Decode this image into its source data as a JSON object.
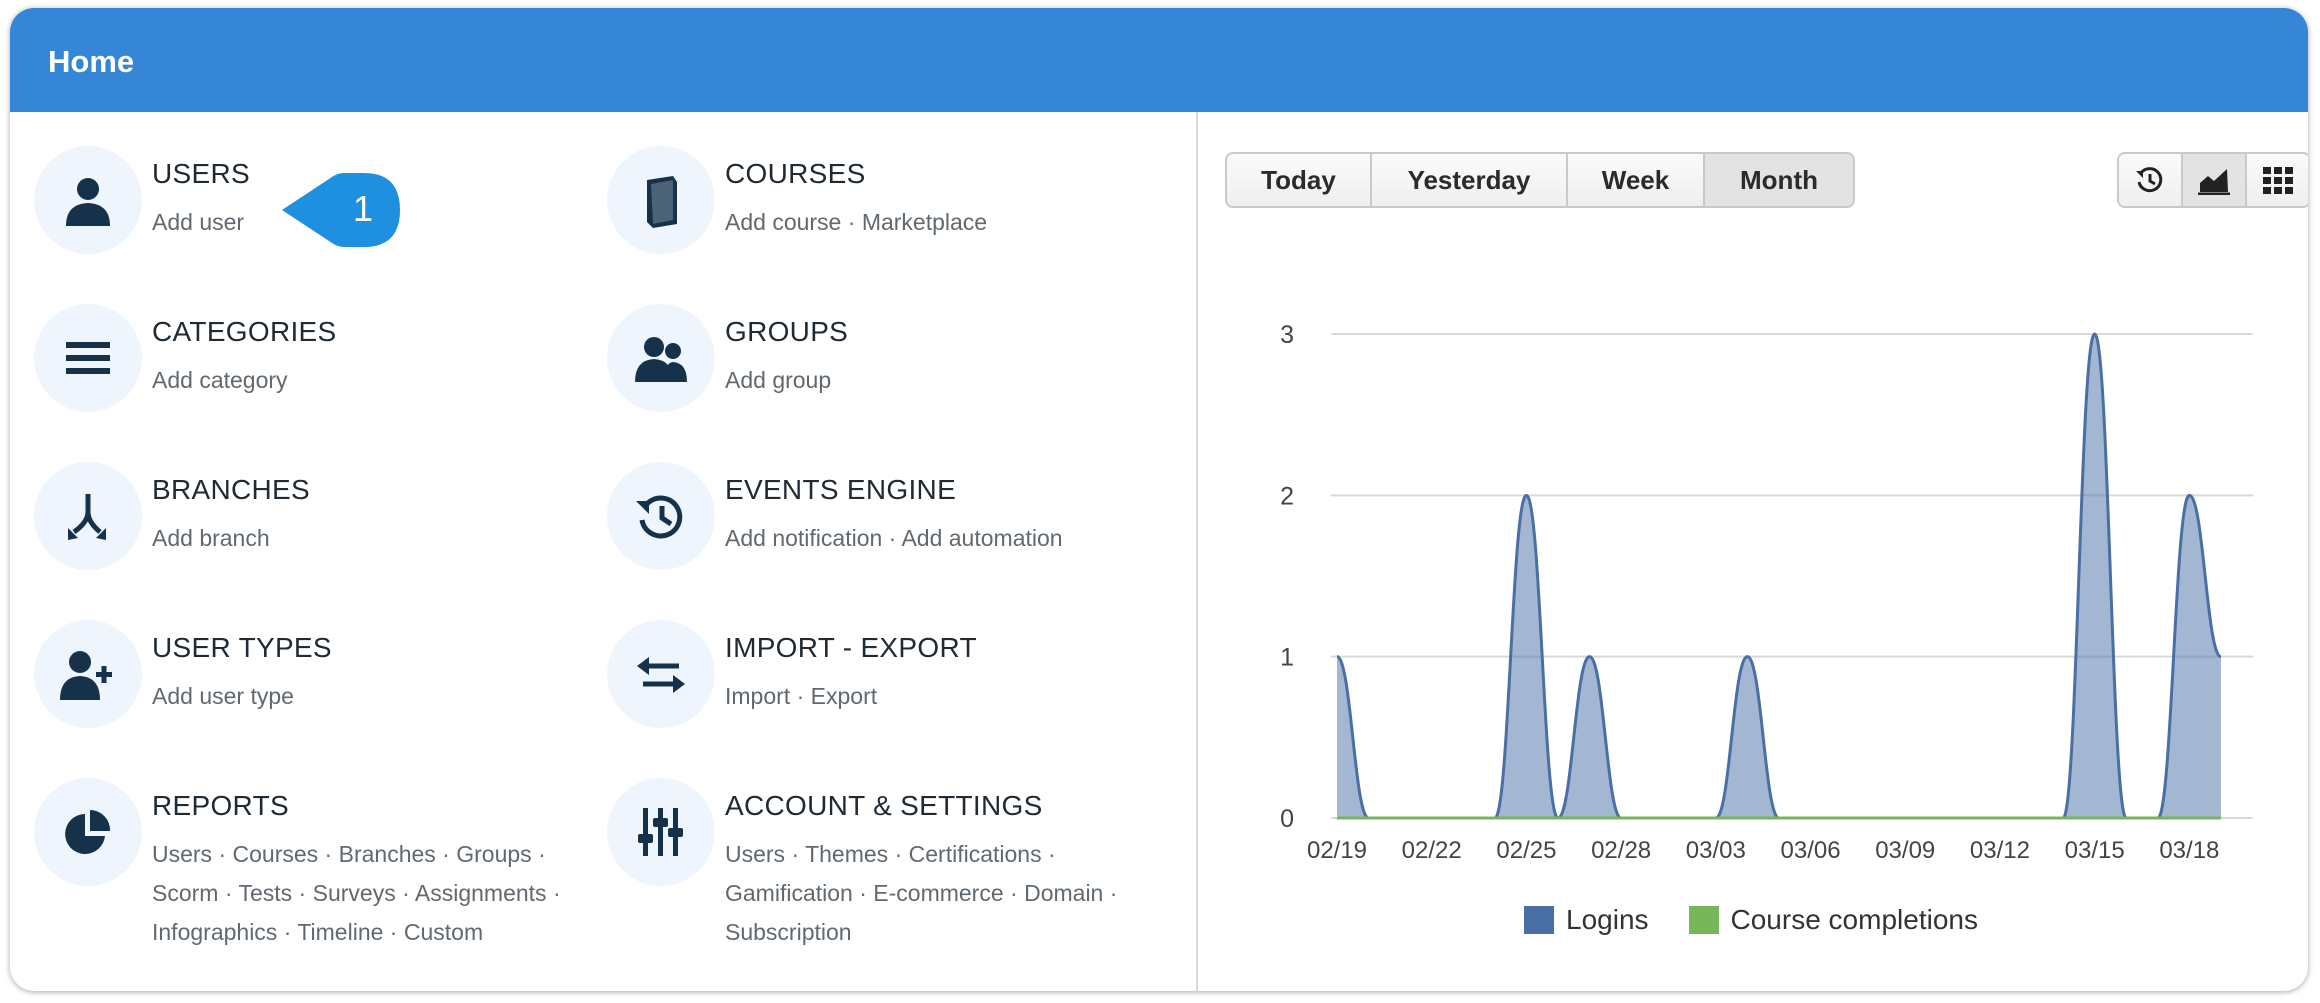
{
  "header": {
    "title": "Home"
  },
  "modules": [
    {
      "key": "users",
      "icon": "user-icon",
      "title": "USERS",
      "lines": [
        [
          "Add user"
        ]
      ]
    },
    {
      "key": "courses",
      "icon": "book-icon",
      "title": "COURSES",
      "lines": [
        [
          "Add course",
          "Marketplace"
        ]
      ]
    },
    {
      "key": "categories",
      "icon": "list-icon",
      "title": "CATEGORIES",
      "lines": [
        [
          "Add category"
        ]
      ]
    },
    {
      "key": "groups",
      "icon": "group-icon",
      "title": "GROUPS",
      "lines": [
        [
          "Add group"
        ]
      ]
    },
    {
      "key": "branches",
      "icon": "branch-icon",
      "title": "BRANCHES",
      "lines": [
        [
          "Add branch"
        ]
      ]
    },
    {
      "key": "events-engine",
      "icon": "history-icon",
      "title": "EVENTS ENGINE",
      "lines": [
        [
          "Add notification",
          "Add automation"
        ]
      ]
    },
    {
      "key": "user-types",
      "icon": "user-plus-icon",
      "title": "USER TYPES",
      "lines": [
        [
          "Add user type"
        ]
      ]
    },
    {
      "key": "import-export",
      "icon": "exchange-icon",
      "title": "IMPORT - EXPORT",
      "lines": [
        [
          "Import",
          "Export"
        ]
      ]
    },
    {
      "key": "reports",
      "icon": "pie-chart-icon",
      "title": "REPORTS",
      "lines": [
        [
          "Users",
          "Courses",
          "Branches",
          "Groups",
          ""
        ],
        [
          "Scorm",
          "Tests",
          "Surveys",
          "Assignments",
          ""
        ],
        [
          "Infographics",
          "Timeline",
          "Custom"
        ]
      ]
    },
    {
      "key": "account-settings",
      "icon": "sliders-icon",
      "title": "ACCOUNT & SETTINGS",
      "lines": [
        [
          "Users",
          "Themes",
          "Certifications",
          ""
        ],
        [
          "Gamification",
          "E-commerce",
          "Domain",
          ""
        ],
        [
          "Subscription"
        ]
      ]
    }
  ],
  "callout": {
    "number": "1",
    "color": "#1f8fe0"
  },
  "range_buttons": [
    "Today",
    "Yesterday",
    "Week",
    "Month"
  ],
  "active_range": "Month",
  "view_buttons": [
    {
      "icon": "history-icon",
      "active": false
    },
    {
      "icon": "area-chart-icon",
      "active": true
    },
    {
      "icon": "grid-icon",
      "active": false
    }
  ],
  "chart_data": {
    "type": "area",
    "x": [
      "02/19",
      "02/20",
      "02/21",
      "02/22",
      "02/23",
      "02/24",
      "02/25",
      "02/26",
      "02/27",
      "02/28",
      "03/01",
      "03/02",
      "03/03",
      "03/04",
      "03/05",
      "03/06",
      "03/07",
      "03/08",
      "03/09",
      "03/10",
      "03/11",
      "03/12",
      "03/13",
      "03/14",
      "03/15",
      "03/16",
      "03/17",
      "03/18",
      "03/19"
    ],
    "xticks": [
      "02/19",
      "02/22",
      "02/25",
      "02/28",
      "03/03",
      "03/06",
      "03/09",
      "03/12",
      "03/15",
      "03/18"
    ],
    "yticks": [
      0,
      1,
      2,
      3
    ],
    "ylim": [
      0,
      3
    ],
    "series": [
      {
        "name": "Logins",
        "color": "#4a6fa5",
        "values": [
          1,
          0,
          0,
          0,
          0,
          0,
          2,
          0,
          1,
          0,
          0,
          0,
          0,
          1,
          0,
          0,
          0,
          0,
          0,
          0,
          0,
          0,
          0,
          0,
          3,
          0,
          0,
          2,
          1
        ]
      },
      {
        "name": "Course completions",
        "color": "#78b55a",
        "values": [
          0,
          0,
          0,
          0,
          0,
          0,
          0,
          0,
          0,
          0,
          0,
          0,
          0,
          0,
          0,
          0,
          0,
          0,
          0,
          0,
          0,
          0,
          0,
          0,
          0,
          0,
          0,
          0,
          0
        ]
      }
    ],
    "grid": true,
    "legend": "bottom"
  }
}
